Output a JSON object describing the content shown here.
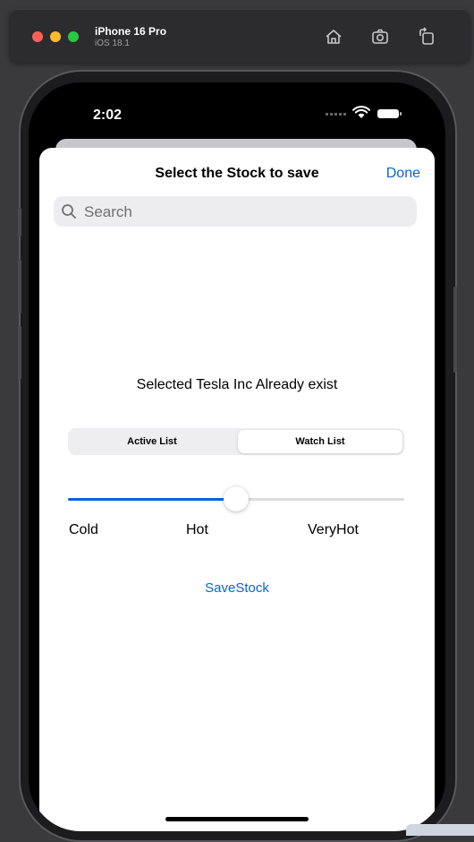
{
  "simulator": {
    "device_name": "iPhone 16 Pro",
    "os_version": "iOS 18.1",
    "icons": [
      "home-icon",
      "screenshot-icon",
      "rotate-icon"
    ]
  },
  "status_bar": {
    "time": "2:02"
  },
  "sheet": {
    "title": "Select the Stock to save",
    "done_label": "Done",
    "search_placeholder": "Search",
    "message": "Selected Tesla Inc Already exist",
    "segments": [
      "Active List",
      "Watch List"
    ],
    "selected_segment": "Watch List",
    "slider": {
      "labels": [
        "Cold",
        "Hot",
        "VeryHot"
      ],
      "value_fraction": 0.5
    },
    "save_label": "SaveStock"
  },
  "colors": {
    "accent": "#0a63d8",
    "background": "#ffffff"
  }
}
